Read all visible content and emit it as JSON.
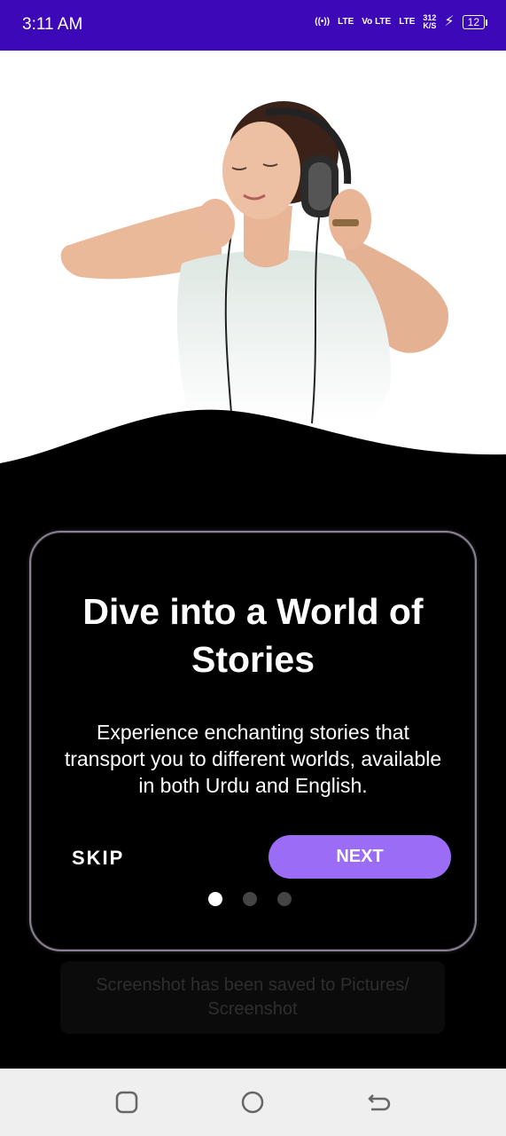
{
  "status_bar": {
    "time": "3:11 AM",
    "signal1": "LTE",
    "signal2": "Vo LTE",
    "signal3": "LTE",
    "speed_value": "312",
    "speed_unit": "K/S",
    "battery": "12",
    "bg_color": "#3c08b8"
  },
  "onboarding": {
    "title": "Dive into a World of Stories",
    "description": "Experience enchanting stories that transport you to different worlds, available in both Urdu and English.",
    "skip_label": "SKIP",
    "next_label": "NEXT",
    "page_count": 3,
    "current_page": 1,
    "accent_color": "#9b6cf6"
  },
  "toast": {
    "message": "Screenshot has been saved to  Pictures/ Screenshot"
  },
  "nav_bar": {
    "icons": [
      "recent-apps-icon",
      "home-icon",
      "back-icon"
    ]
  }
}
